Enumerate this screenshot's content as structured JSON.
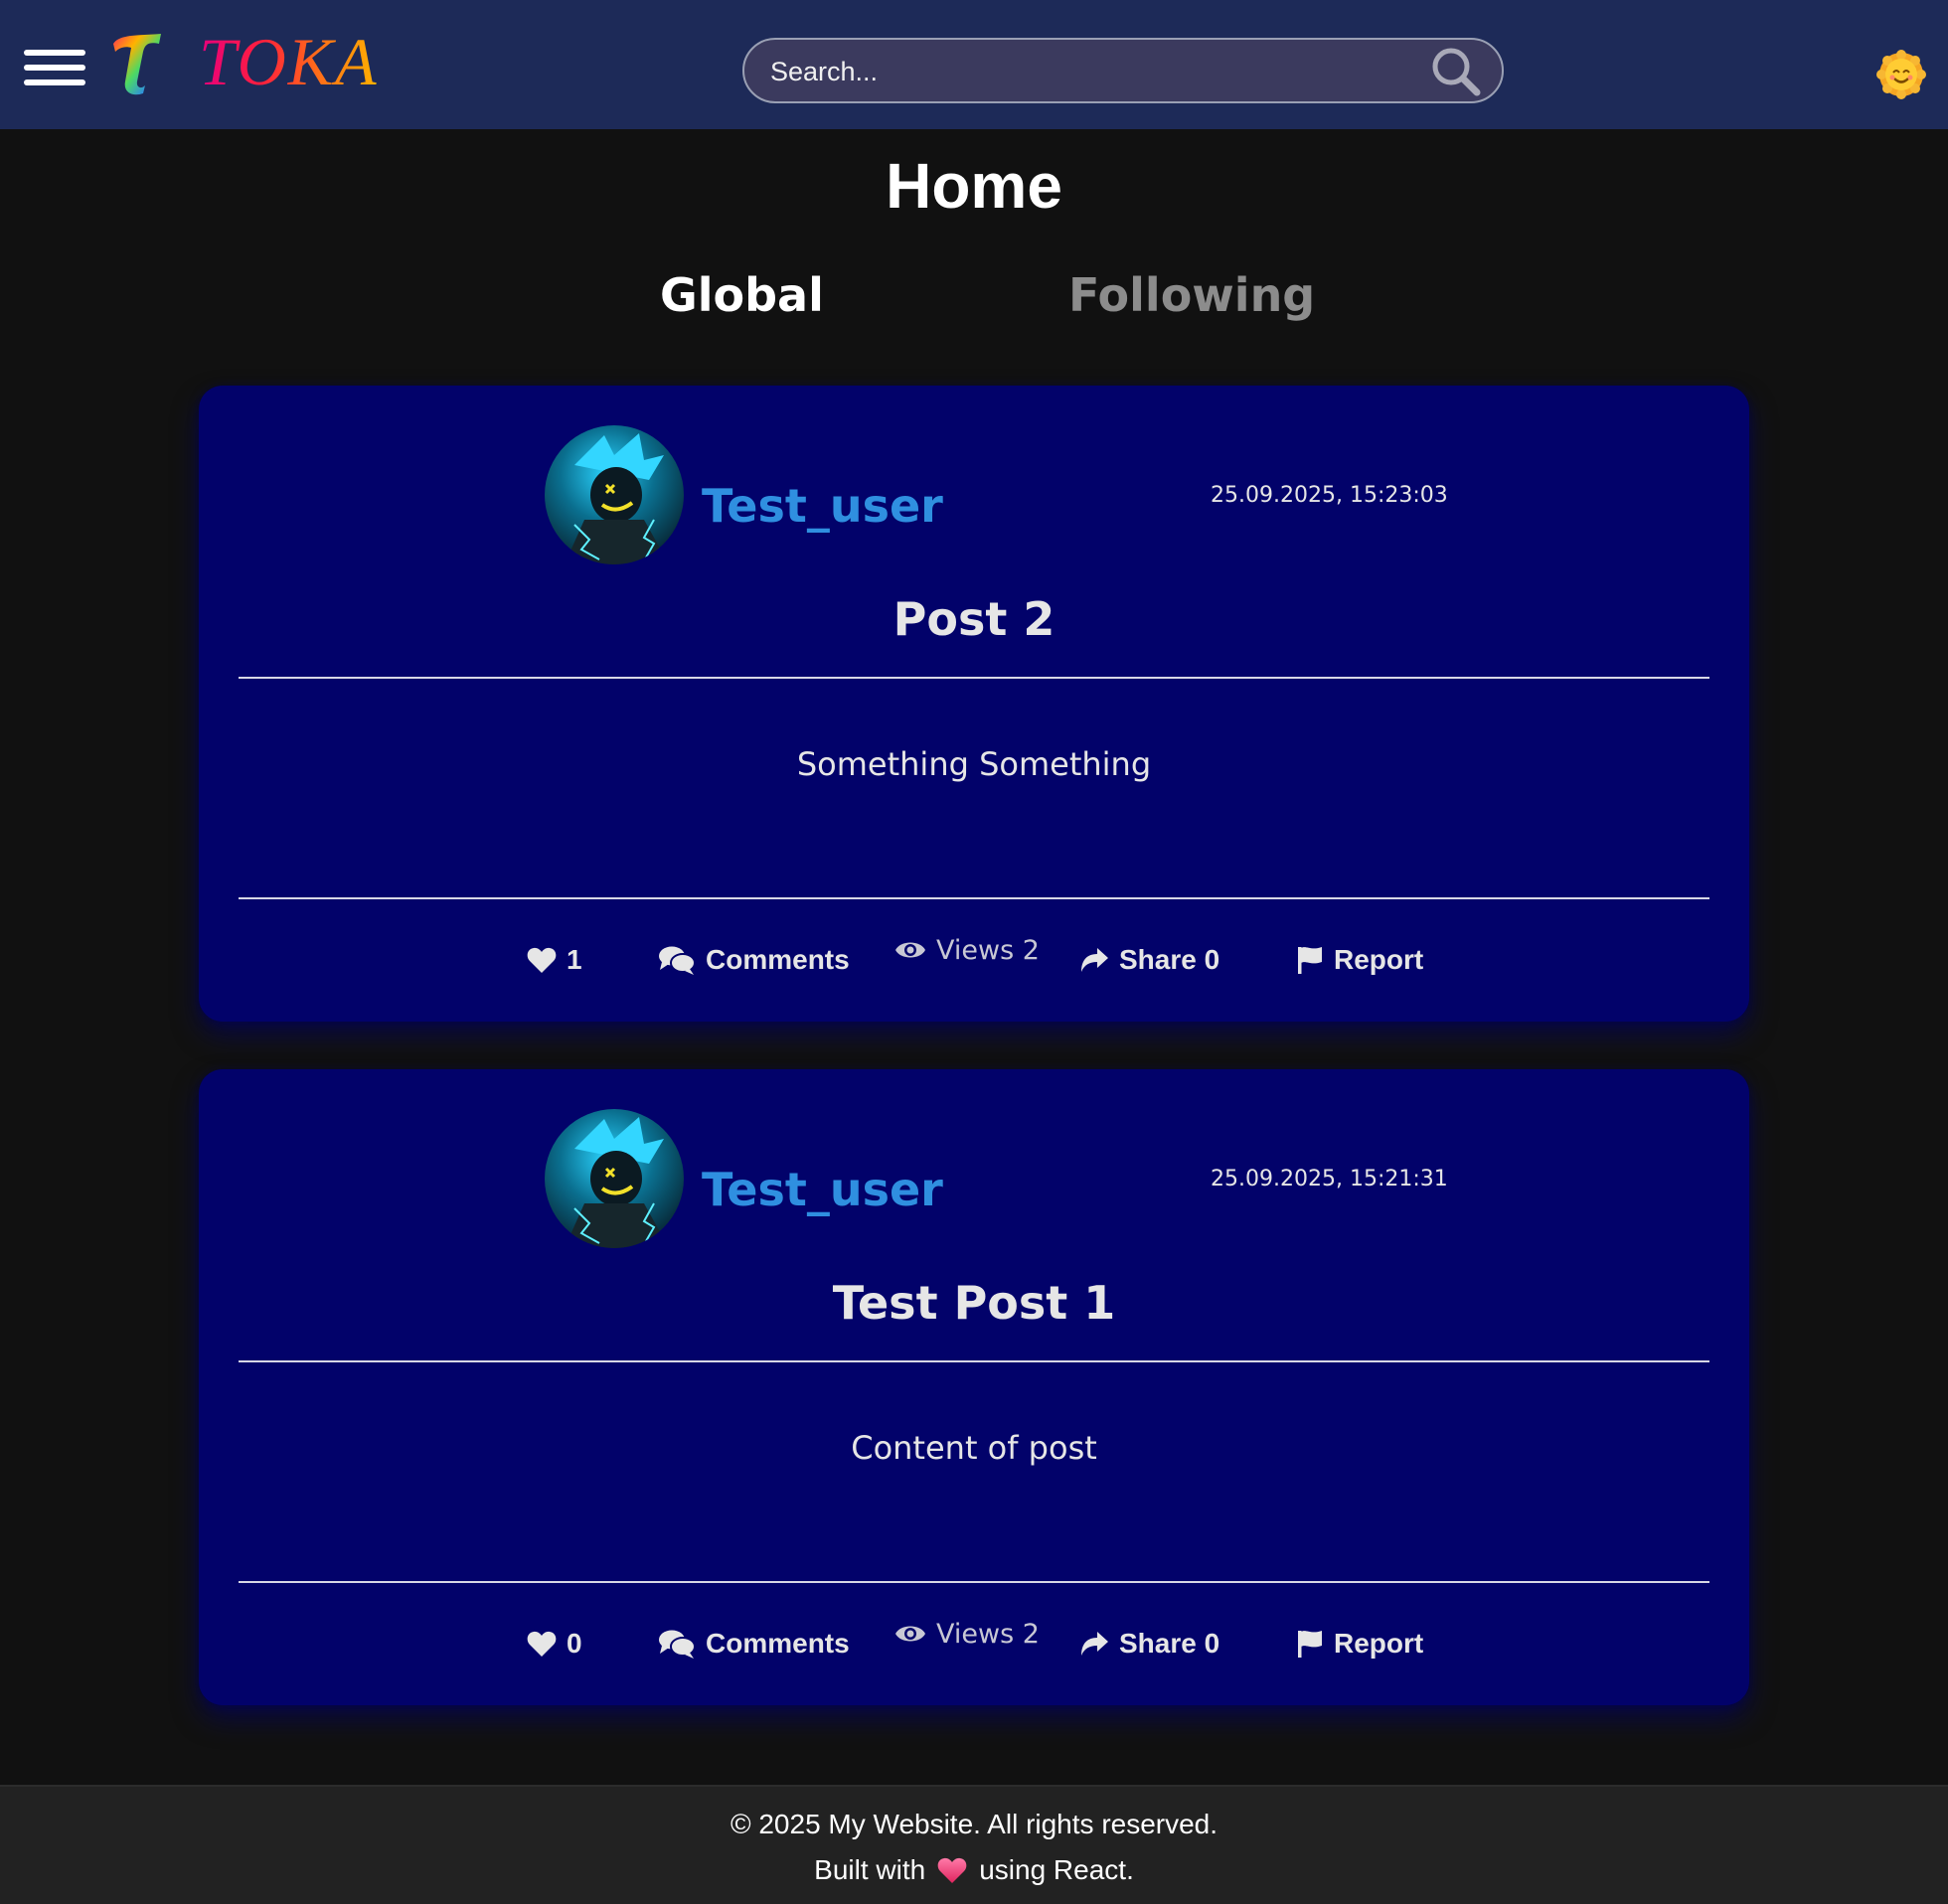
{
  "header": {
    "logo_letter": "T",
    "logo_text": "TOKA",
    "search": {
      "placeholder": "Search...",
      "value": ""
    },
    "icons": {
      "menu": "hamburger-menu-icon",
      "search": "magnifier-icon",
      "theme": "sun-face-icon"
    }
  },
  "page": {
    "title": "Home",
    "tabs": [
      {
        "label": "Global",
        "active": true
      },
      {
        "label": "Following",
        "active": false
      }
    ]
  },
  "posts": [
    {
      "username": "Test_user",
      "timestamp": "25.09.2025, 15:23:03",
      "title": "Post 2",
      "body": "Something Something",
      "likes": "1",
      "comments_label": "Comments",
      "views_label": "Views 2",
      "share_label": "Share 0",
      "report_label": "Report"
    },
    {
      "username": "Test_user",
      "timestamp": "25.09.2025, 15:21:31",
      "title": "Test Post 1",
      "body": "Content of post",
      "likes": "0",
      "comments_label": "Comments",
      "views_label": "Views 2",
      "share_label": "Share 0",
      "report_label": "Report"
    }
  ],
  "footer": {
    "copyright": "© 2025 My Website. All rights reserved.",
    "built_prefix": "Built with",
    "built_suffix": "using React."
  },
  "colors": {
    "header_bg": "#1d2a58",
    "page_bg": "#111111",
    "card_bg": "#02026a",
    "username": "#2f8fe0",
    "footer_bg": "#222222",
    "heart": "#ff3d6e"
  }
}
